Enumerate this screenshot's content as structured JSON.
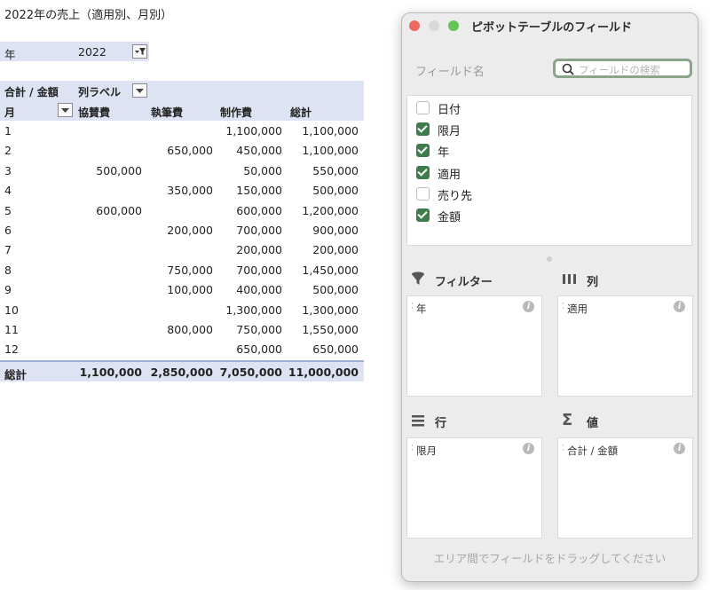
{
  "sheet": {
    "title": "2022年の売上（適用別、月別）",
    "filter": {
      "label": "年",
      "value": "2022"
    },
    "pivot": {
      "corner_label": "合計 / 金額",
      "col_label": "列ラベル",
      "row_header": "月",
      "columns": [
        "協賛費",
        "執筆費",
        "制作費",
        "総計"
      ],
      "rows": [
        {
          "m": "1",
          "a": "",
          "b": "",
          "c": "1,100,000",
          "t": "1,100,000"
        },
        {
          "m": "2",
          "a": "",
          "b": "650,000",
          "c": "450,000",
          "t": "1,100,000"
        },
        {
          "m": "3",
          "a": "500,000",
          "b": "",
          "c": "50,000",
          "t": "550,000"
        },
        {
          "m": "4",
          "a": "",
          "b": "350,000",
          "c": "150,000",
          "t": "500,000"
        },
        {
          "m": "5",
          "a": "600,000",
          "b": "",
          "c": "600,000",
          "t": "1,200,000"
        },
        {
          "m": "6",
          "a": "",
          "b": "200,000",
          "c": "700,000",
          "t": "900,000"
        },
        {
          "m": "7",
          "a": "",
          "b": "",
          "c": "200,000",
          "t": "200,000"
        },
        {
          "m": "8",
          "a": "",
          "b": "750,000",
          "c": "700,000",
          "t": "1,450,000"
        },
        {
          "m": "9",
          "a": "",
          "b": "100,000",
          "c": "400,000",
          "t": "500,000"
        },
        {
          "m": "10",
          "a": "",
          "b": "",
          "c": "1,300,000",
          "t": "1,300,000"
        },
        {
          "m": "11",
          "a": "",
          "b": "800,000",
          "c": "750,000",
          "t": "1,550,000"
        },
        {
          "m": "12",
          "a": "",
          "b": "",
          "c": "650,000",
          "t": "650,000"
        }
      ],
      "total": {
        "m": "総計",
        "a": "1,100,000",
        "b": "2,850,000",
        "c": "7,050,000",
        "t": "11,000,000"
      }
    }
  },
  "panel": {
    "title": "ピボットテーブルのフィールド",
    "field_name_label": "フィールド名",
    "search_placeholder": "フィールドの検索",
    "fields": [
      {
        "label": "日付",
        "checked": false
      },
      {
        "label": "限月",
        "checked": true
      },
      {
        "label": "年",
        "checked": true
      },
      {
        "label": "適用",
        "checked": true
      },
      {
        "label": "売り先",
        "checked": false
      },
      {
        "label": "金額",
        "checked": true
      }
    ],
    "areas": {
      "filter": {
        "title": "フィルター",
        "item": "年",
        "icon": "funnel-icon"
      },
      "columns": {
        "title": "列",
        "item": "適用",
        "icon": "columns-icon"
      },
      "rows": {
        "title": "行",
        "item": "限月",
        "icon": "rows-icon"
      },
      "values": {
        "title": "値",
        "item": "合計 / 金額",
        "icon": "sigma-icon"
      }
    },
    "footer": "エリア間でフィールドをドラッグしてください",
    "colors": {
      "close": "#ec6a5e",
      "minimize": "#d9d9d9",
      "zoom": "#62c554",
      "check": "#3e7d4b",
      "header_band": "#dde3f2"
    }
  }
}
